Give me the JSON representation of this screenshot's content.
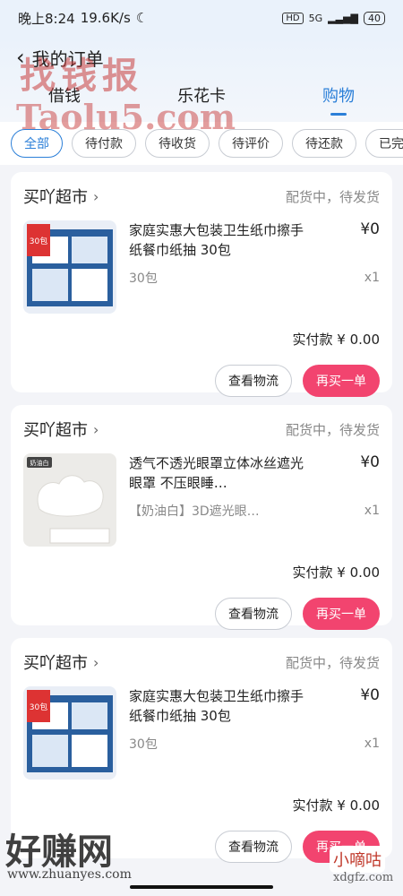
{
  "status_bar": {
    "time": "晚上8:24",
    "speed": "19.6K/s",
    "hd": "HD",
    "network": "5G",
    "battery": "40"
  },
  "header": {
    "title": "我的订单",
    "tabs": [
      {
        "label": "借钱",
        "active": false
      },
      {
        "label": "乐花卡",
        "active": false
      },
      {
        "label": "购物",
        "active": true
      }
    ]
  },
  "filters": [
    "全部",
    "待付款",
    "待收货",
    "待评价",
    "待还款",
    "已完"
  ],
  "orders": [
    {
      "store": "买吖超市",
      "status": "配货中，待发货",
      "title": "家庭实惠大包装卫生纸巾擦手纸餐巾纸抽 30包",
      "spec": "30包",
      "price": "¥0",
      "qty": "x1",
      "paid": "实付款 ¥ 0.00",
      "btn_logistics": "查看物流",
      "btn_rebuy": "再买一单",
      "thumb_text": "30包"
    },
    {
      "store": "买吖超市",
      "status": "配货中，待发货",
      "title": "透气不透光眼罩立体冰丝遮光眼罩 不压眼睡…",
      "spec": "【奶油白】3D遮光眼…",
      "price": "¥0",
      "qty": "x1",
      "paid": "实付款 ¥ 0.00",
      "btn_logistics": "查看物流",
      "btn_rebuy": "再买一单",
      "thumb_text": "奶油白"
    },
    {
      "store": "买吖超市",
      "status": "配货中，待发货",
      "title": "家庭实惠大包装卫生纸巾擦手纸餐巾纸抽 30包",
      "spec": "30包",
      "price": "¥0",
      "qty": "x1",
      "paid": "实付款 ¥ 0.00",
      "btn_logistics": "查看物流",
      "btn_rebuy": "再买一单",
      "thumb_text": "30包"
    }
  ],
  "watermarks": {
    "top1": "找钱报",
    "top2": "Taolu5.com",
    "bottom1": "好赚网",
    "bottom2": "www.zhuanyes.com",
    "bottom3": "小嘀咕",
    "bottom4": "xdgfz.com"
  },
  "colors": {
    "accent": "#2b7fd8",
    "rebuy": "#f2446f"
  }
}
